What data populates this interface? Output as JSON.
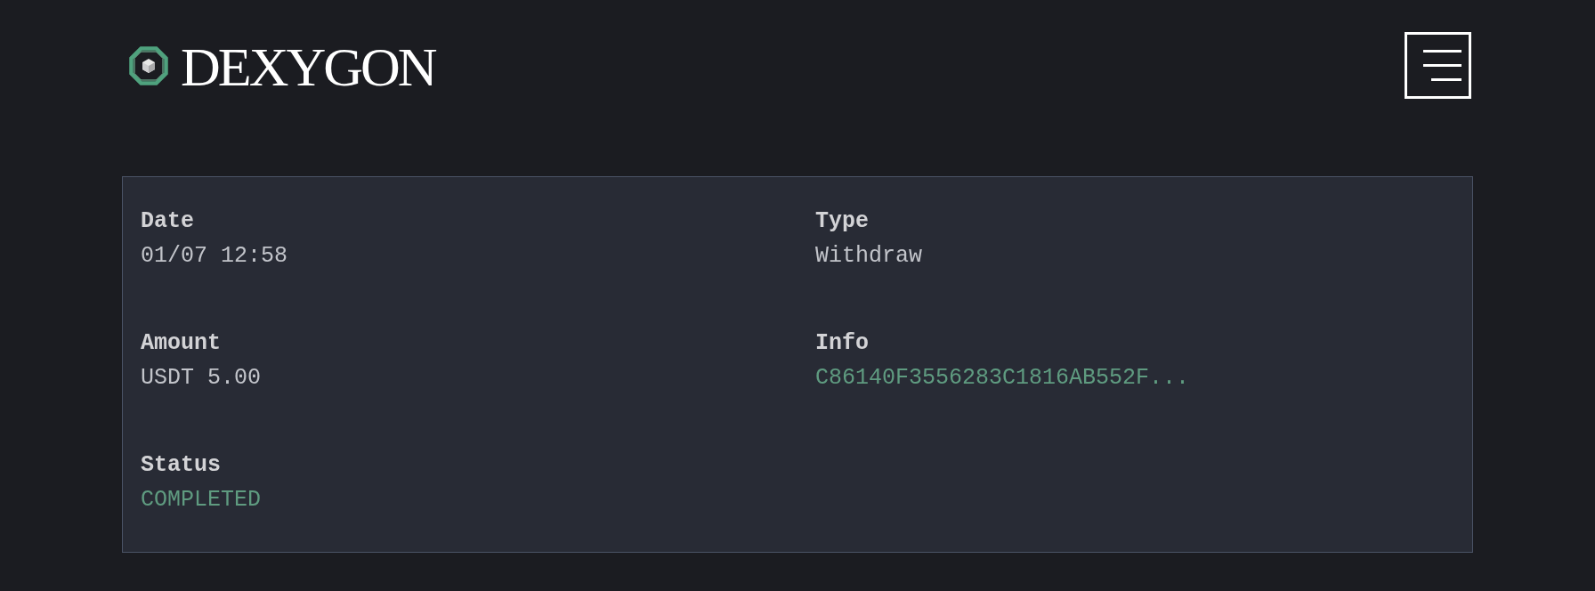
{
  "header": {
    "logo_text": "DEXYGON"
  },
  "transaction": {
    "fields": [
      {
        "label": "Date",
        "value": "01/07 12:58",
        "kind": "text"
      },
      {
        "label": "Type",
        "value": "Withdraw",
        "kind": "text"
      },
      {
        "label": "Amount",
        "value": "USDT 5.00",
        "kind": "text"
      },
      {
        "label": "Info",
        "value": "C86140F3556283C1816AB552F...",
        "kind": "link"
      },
      {
        "label": "Status",
        "value": "COMPLETED",
        "kind": "status"
      }
    ]
  }
}
